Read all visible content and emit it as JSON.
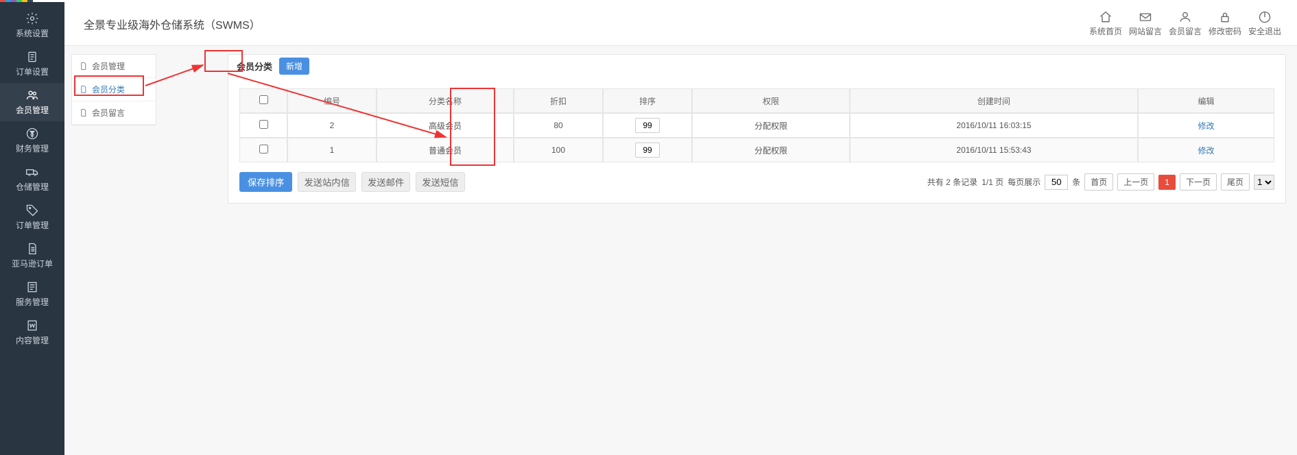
{
  "app_title": "全景专业级海外仓储系统（SWMS）",
  "header_actions": [
    {
      "key": "sys_home",
      "label": "系统首页"
    },
    {
      "key": "site_msg",
      "label": "网站留言"
    },
    {
      "key": "member_msg",
      "label": "会员留言"
    },
    {
      "key": "change_pwd",
      "label": "修改密码"
    },
    {
      "key": "logout",
      "label": "安全退出"
    }
  ],
  "sidenav": [
    {
      "key": "system",
      "label": "系统设置"
    },
    {
      "key": "order_set",
      "label": "订单设置"
    },
    {
      "key": "member",
      "label": "会员管理"
    },
    {
      "key": "finance",
      "label": "财务管理"
    },
    {
      "key": "warehouse",
      "label": "仓储管理"
    },
    {
      "key": "order",
      "label": "订单管理"
    },
    {
      "key": "amazon",
      "label": "亚马逊订单"
    },
    {
      "key": "service",
      "label": "服务管理"
    },
    {
      "key": "content",
      "label": "内容管理"
    }
  ],
  "subnav": [
    {
      "key": "member_mgmt",
      "label": "会员管理"
    },
    {
      "key": "member_cat",
      "label": "会员分类"
    },
    {
      "key": "member_msg",
      "label": "会员留言"
    }
  ],
  "tab_title": "会员分类",
  "btn_new": "新增",
  "table": {
    "columns": [
      "",
      "编号",
      "分类名称",
      "折扣",
      "排序",
      "权限",
      "创建时间",
      "编辑"
    ],
    "rows": [
      {
        "id": "2",
        "name": "高级会员",
        "discount": "80",
        "sort": "99",
        "perm": "分配权限",
        "time": "2016/10/11 16:03:15",
        "edit": "修改"
      },
      {
        "id": "1",
        "name": "普通会员",
        "discount": "100",
        "sort": "99",
        "perm": "分配权限",
        "time": "2016/10/11 15:53:43",
        "edit": "修改"
      }
    ]
  },
  "footer_buttons": {
    "save": "保存排序",
    "send_pm": "发送站内信",
    "send_mail": "发送邮件",
    "send_sms": "发送短信"
  },
  "pager": {
    "total_prefix": "共有",
    "total_count": "2",
    "total_suffix": "条记录",
    "pages": "1/1 页",
    "perpage_label": "每页展示",
    "perpage_value": "50",
    "unit": "条",
    "first": "首页",
    "prev": "上一页",
    "current": "1",
    "next": "下一页",
    "last": "尾页",
    "select": "1"
  }
}
